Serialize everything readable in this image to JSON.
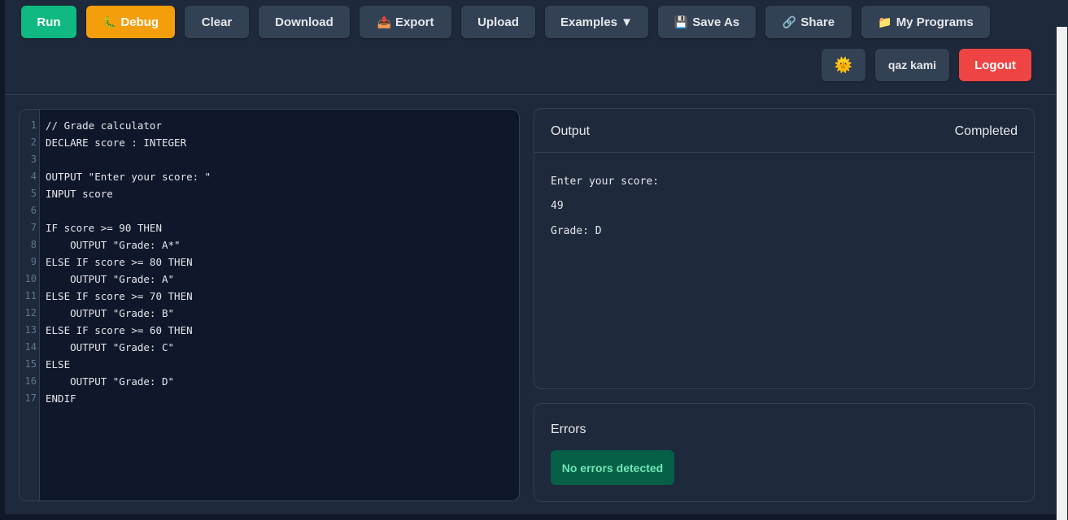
{
  "toolbar": {
    "run": "Run",
    "debug": "Debug",
    "debug_icon": "caterpillar-icon",
    "clear": "Clear",
    "download": "Download",
    "export": "Export",
    "export_icon": "export-tray-icon",
    "upload": "Upload",
    "examples": "Examples ▼",
    "save_as": "Save As",
    "save_icon": "floppy-disk-icon",
    "share": "Share",
    "share_icon": "link-icon",
    "my_programs": "My Programs",
    "my_programs_icon": "folder-icon",
    "theme_icon": "sun-icon",
    "username": "qaz kami",
    "logout": "Logout"
  },
  "editor": {
    "lines": [
      "// Grade calculator",
      "DECLARE score : INTEGER",
      "",
      "OUTPUT \"Enter your score: \"",
      "INPUT score",
      "",
      "IF score >= 90 THEN",
      "    OUTPUT \"Grade: A*\"",
      "ELSE IF score >= 80 THEN",
      "    OUTPUT \"Grade: A\"",
      "ELSE IF score >= 70 THEN",
      "    OUTPUT \"Grade: B\"",
      "ELSE IF score >= 60 THEN",
      "    OUTPUT \"Grade: C\"",
      "ELSE",
      "    OUTPUT \"Grade: D\"",
      "ENDIF"
    ]
  },
  "output": {
    "title": "Output",
    "status": "Completed",
    "lines": [
      "Enter your score:",
      "49",
      "Grade: D"
    ]
  },
  "errors": {
    "title": "Errors",
    "message": "No errors detected"
  },
  "colors": {
    "run": "#10b981",
    "debug": "#f59e0b",
    "logout": "#ef4444",
    "success_badge": "#065f46"
  }
}
